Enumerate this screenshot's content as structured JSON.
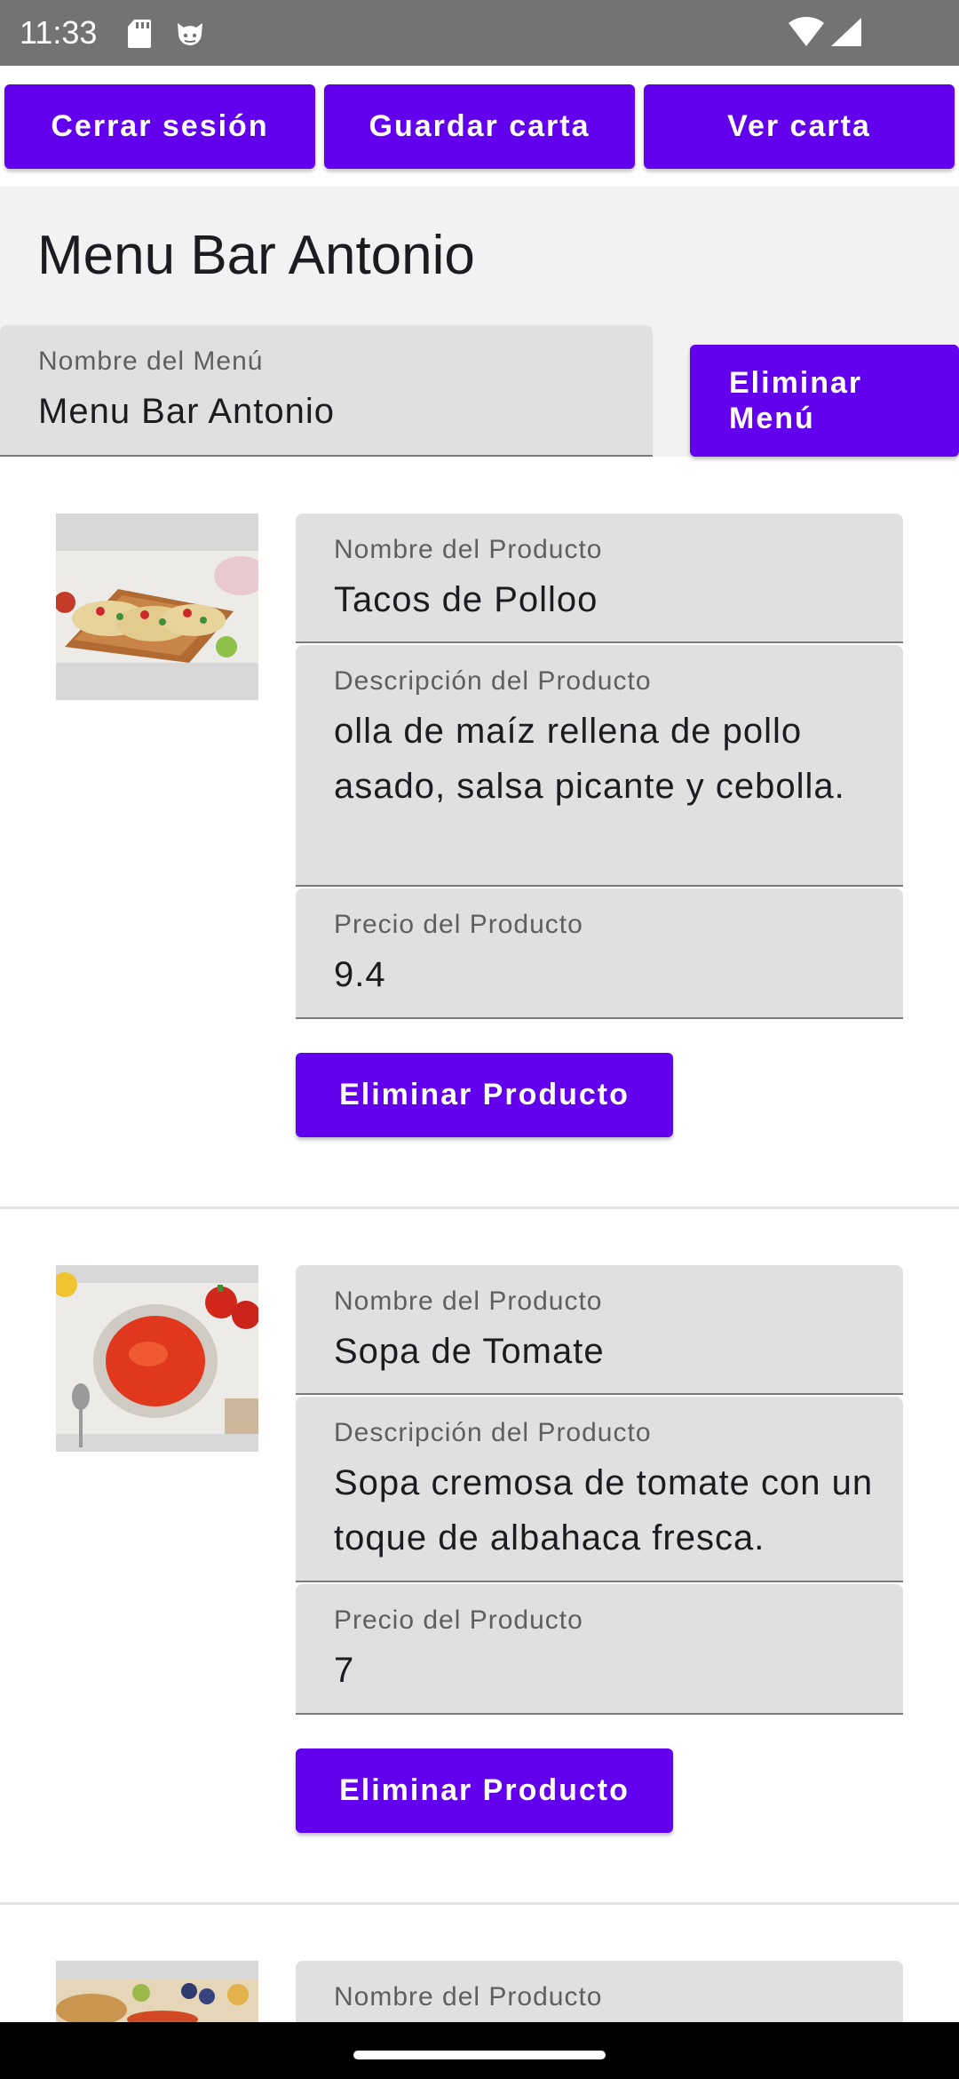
{
  "status_bar": {
    "time": "11:33",
    "icons": [
      "sd-card-icon",
      "cat-face-icon",
      "wifi-icon",
      "signal-icon"
    ]
  },
  "toolbar": {
    "logout_label": "Cerrar sesión",
    "save_label": "Guardar carta",
    "view_label": "Ver carta"
  },
  "menu": {
    "title": "Menu Bar Antonio",
    "name_label": "Nombre del Menú",
    "name_value": "Menu Bar Antonio",
    "delete_label_line1": "Eliminar",
    "delete_label_line2": "Menú"
  },
  "products": [
    {
      "image": "tacos-image",
      "name_label": "Nombre del Producto",
      "name_value": "Tacos de Polloo",
      "desc_label": "Descripción del Producto",
      "desc_value": "olla de maíz rellena de pollo asado, salsa picante y cebolla.",
      "price_label": "Precio del Producto",
      "price_value": "9.4",
      "delete_label": "Eliminar Producto"
    },
    {
      "image": "tomato-soup-image",
      "name_label": "Nombre del Producto",
      "name_value": "Sopa de Tomate",
      "desc_label": "Descripción del Producto",
      "desc_value": "Sopa cremosa de tomate con un toque de albahaca fresca.",
      "price_label": "Precio del Producto",
      "price_value": "7",
      "delete_label": "Eliminar Producto"
    },
    {
      "image": "food-image",
      "name_label": "Nombre del Producto"
    }
  ],
  "colors": {
    "primary": "#6200ee",
    "status_bar": "#737373",
    "field_bg": "#e0e0e0",
    "band_bg": "#f2f2f2"
  }
}
